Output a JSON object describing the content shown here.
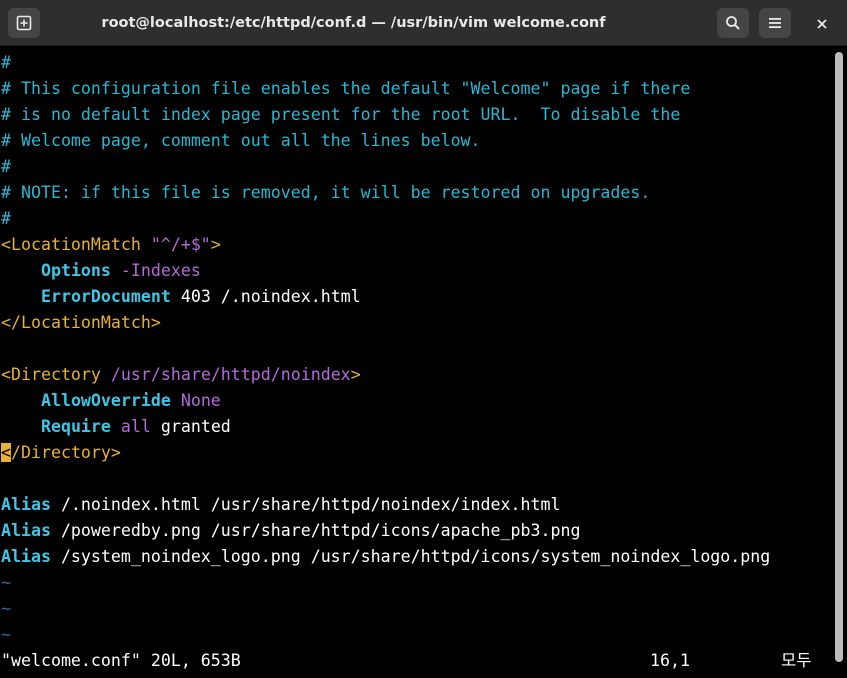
{
  "window": {
    "title": "root@localhost:/etc/httpd/conf.d — /usr/bin/vim welcome.conf"
  },
  "editor": {
    "lines": [
      {
        "parts": [
          {
            "t": "#",
            "c": "comment"
          }
        ]
      },
      {
        "parts": [
          {
            "t": "# This configuration file enables the default \"Welcome\" page if there",
            "c": "comment"
          }
        ]
      },
      {
        "parts": [
          {
            "t": "# is no default index page present for the root URL.  To disable the",
            "c": "comment"
          }
        ]
      },
      {
        "parts": [
          {
            "t": "# Welcome page, comment out all the lines below.",
            "c": "comment"
          }
        ]
      },
      {
        "parts": [
          {
            "t": "#",
            "c": "comment"
          }
        ]
      },
      {
        "parts": [
          {
            "t": "# NOTE: if this file is removed, it will be restored on upgrades.",
            "c": "comment"
          }
        ]
      },
      {
        "parts": [
          {
            "t": "#",
            "c": "comment"
          }
        ]
      },
      {
        "parts": [
          {
            "t": "<LocationMatch ",
            "c": "tag"
          },
          {
            "t": "\"^/+$\"",
            "c": "str"
          },
          {
            "t": ">",
            "c": "tag"
          }
        ]
      },
      {
        "parts": [
          {
            "t": "    ",
            "c": "plain"
          },
          {
            "t": "Options",
            "c": "kw"
          },
          {
            "t": " -Indexes",
            "c": "str"
          }
        ]
      },
      {
        "parts": [
          {
            "t": "    ",
            "c": "plain"
          },
          {
            "t": "ErrorDocument",
            "c": "kw"
          },
          {
            "t": " 403 /.noindex.html",
            "c": "plain"
          }
        ]
      },
      {
        "parts": [
          {
            "t": "</LocationMatch>",
            "c": "tag"
          }
        ]
      },
      {
        "parts": []
      },
      {
        "parts": [
          {
            "t": "<Directory ",
            "c": "tag"
          },
          {
            "t": "/usr/share/httpd/noindex",
            "c": "str"
          },
          {
            "t": ">",
            "c": "tag"
          }
        ]
      },
      {
        "parts": [
          {
            "t": "    ",
            "c": "plain"
          },
          {
            "t": "AllowOverride",
            "c": "kw"
          },
          {
            "t": " None",
            "c": "str"
          }
        ]
      },
      {
        "parts": [
          {
            "t": "    ",
            "c": "plain"
          },
          {
            "t": "Require",
            "c": "kw"
          },
          {
            "t": " all",
            "c": "str"
          },
          {
            "t": " granted",
            "c": "plain"
          }
        ]
      },
      {
        "parts": [
          {
            "t": "<",
            "c": "cursor"
          },
          {
            "t": "/Directory>",
            "c": "tag"
          }
        ]
      },
      {
        "parts": []
      },
      {
        "parts": [
          {
            "t": "Alias",
            "c": "kw"
          },
          {
            "t": " /.noindex.html /usr/share/httpd/noindex/index.html",
            "c": "plain"
          }
        ]
      },
      {
        "parts": [
          {
            "t": "Alias",
            "c": "kw"
          },
          {
            "t": " /poweredby.png /usr/share/httpd/icons/apache_pb3.png",
            "c": "plain"
          }
        ]
      },
      {
        "parts": [
          {
            "t": "Alias",
            "c": "kw"
          },
          {
            "t": " /system_noindex_logo.png /usr/share/httpd/icons/system_noindex_logo.png",
            "c": "plain"
          }
        ]
      },
      {
        "parts": [
          {
            "t": "~",
            "c": "tilde"
          }
        ]
      },
      {
        "parts": [
          {
            "t": "~",
            "c": "tilde"
          }
        ]
      },
      {
        "parts": [
          {
            "t": "~",
            "c": "tilde"
          }
        ]
      }
    ],
    "status": {
      "file_info": "\"welcome.conf\" 20L, 653B",
      "position": "16,1",
      "scroll": "모두"
    }
  },
  "icons": {
    "new_tab": "new-tab-icon",
    "search": "search-icon",
    "menu": "hamburger-menu-icon",
    "close": "close-icon"
  },
  "colors": {
    "comment": "#28b7d3",
    "tag": "#e8b135",
    "string": "#b36ad8",
    "keyword": "#3ec6e6",
    "titlebar": "#2e2e2e"
  }
}
